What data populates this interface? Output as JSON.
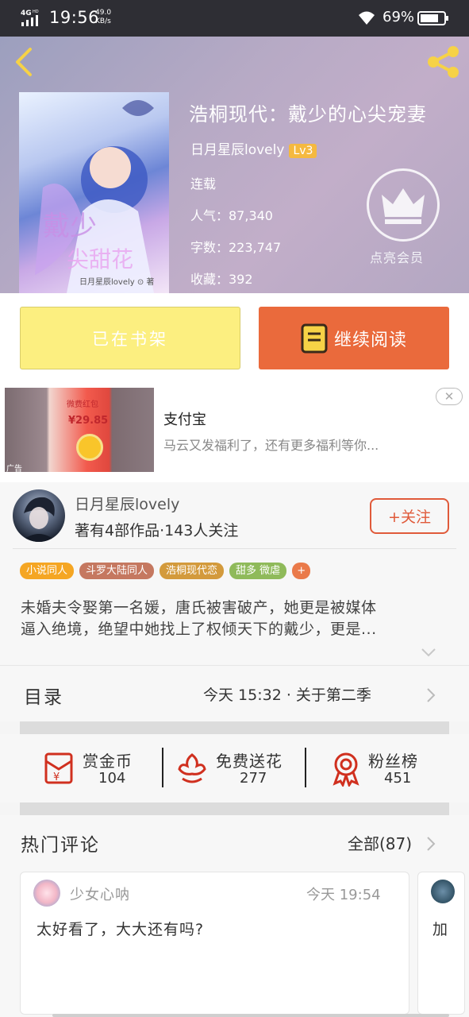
{
  "status_bar": {
    "network": "4G HD",
    "time": "19:56",
    "speed_value": "49.0",
    "speed_unit": "KB/s",
    "battery": "69%"
  },
  "header": {
    "book_title": "浩桐现代：戴少的心尖宠妻",
    "author": "日月星辰lovely",
    "level": "Lv3",
    "status": "连载",
    "popularity": "人气：87,340",
    "word_count": "字数：223,747",
    "favorites": "收藏：392",
    "vip_label": "点亮会员",
    "cover_signature": "日月星辰lovely ⊙ 著"
  },
  "actions": {
    "shelf_label": "已在书架",
    "read_label": "继续阅读"
  },
  "ad": {
    "title": "支付宝",
    "description": "马云又发福利了，还有更多福利等你...",
    "tag": "广告",
    "close_symbol": "✕",
    "image_amount": "¥29.85",
    "image_caption": "微费红包"
  },
  "author_section": {
    "name": "日月星辰lovely",
    "stats": "著有4部作品·143人关注",
    "follow_label": "+关注",
    "tags": [
      {
        "label": "小说同人",
        "color": "#f5a623"
      },
      {
        "label": "斗罗大陆同人",
        "color": "#c57860"
      },
      {
        "label": "浩桐现代恋",
        "color": "#d39a3c"
      },
      {
        "label": "甜多 微虐",
        "color": "#8fba5a"
      },
      {
        "label": "+",
        "color": "#ea7a4a"
      }
    ],
    "description_lines": [
      "未婚夫令娶第一名媛，唐氏被害破产，她更是被媒体",
      "逼入绝境，绝望中她找上了权倾天下的戴少，更是..."
    ]
  },
  "toc": {
    "label": "目录",
    "latest": "今天 15:32 · 关于第二季"
  },
  "support": {
    "items": [
      {
        "label": "赏金币",
        "count": "104",
        "icon": "red-envelope-icon"
      },
      {
        "label": "免费送花",
        "count": "277",
        "icon": "flower-icon"
      },
      {
        "label": "粉丝榜",
        "count": "451",
        "icon": "medal-icon"
      }
    ]
  },
  "comments": {
    "title": "热门评论",
    "all_label": "全部(87)",
    "items": [
      {
        "user": "少女心呐",
        "time": "今天 19:54",
        "text": "太好看了，大大还有吗?"
      },
      {
        "text": "加"
      }
    ]
  },
  "colors": {
    "accent_orange": "#ea6a3c",
    "shelf_yellow": "#fcef80",
    "follow_red": "#e05a3a"
  }
}
